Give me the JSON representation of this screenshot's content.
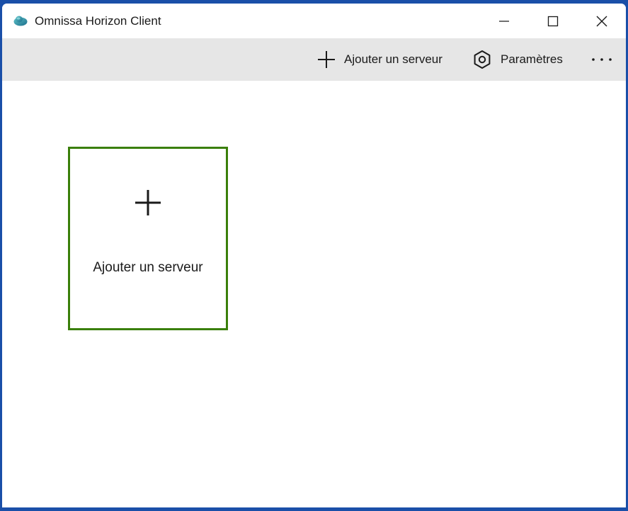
{
  "window": {
    "title": "Omnissa Horizon Client",
    "app_icon": "cloud-logo-icon",
    "controls": {
      "minimize_icon": "minimize-icon",
      "maximize_icon": "maximize-icon",
      "close_icon": "close-icon"
    }
  },
  "toolbar": {
    "add_server_label": "Ajouter un serveur",
    "add_server_icon": "plus-icon",
    "settings_label": "Paramètres",
    "settings_icon": "gear-icon",
    "more_icon": "more-options-icon"
  },
  "main": {
    "add_server_tile": {
      "label": "Ajouter un serveur",
      "icon": "plus-icon",
      "border_color": "#3a7f0a"
    }
  },
  "colors": {
    "toolbar_bg": "#e6e6e6",
    "accent_green": "#3a7f0a",
    "desktop_blue": "#1a4fa8"
  }
}
